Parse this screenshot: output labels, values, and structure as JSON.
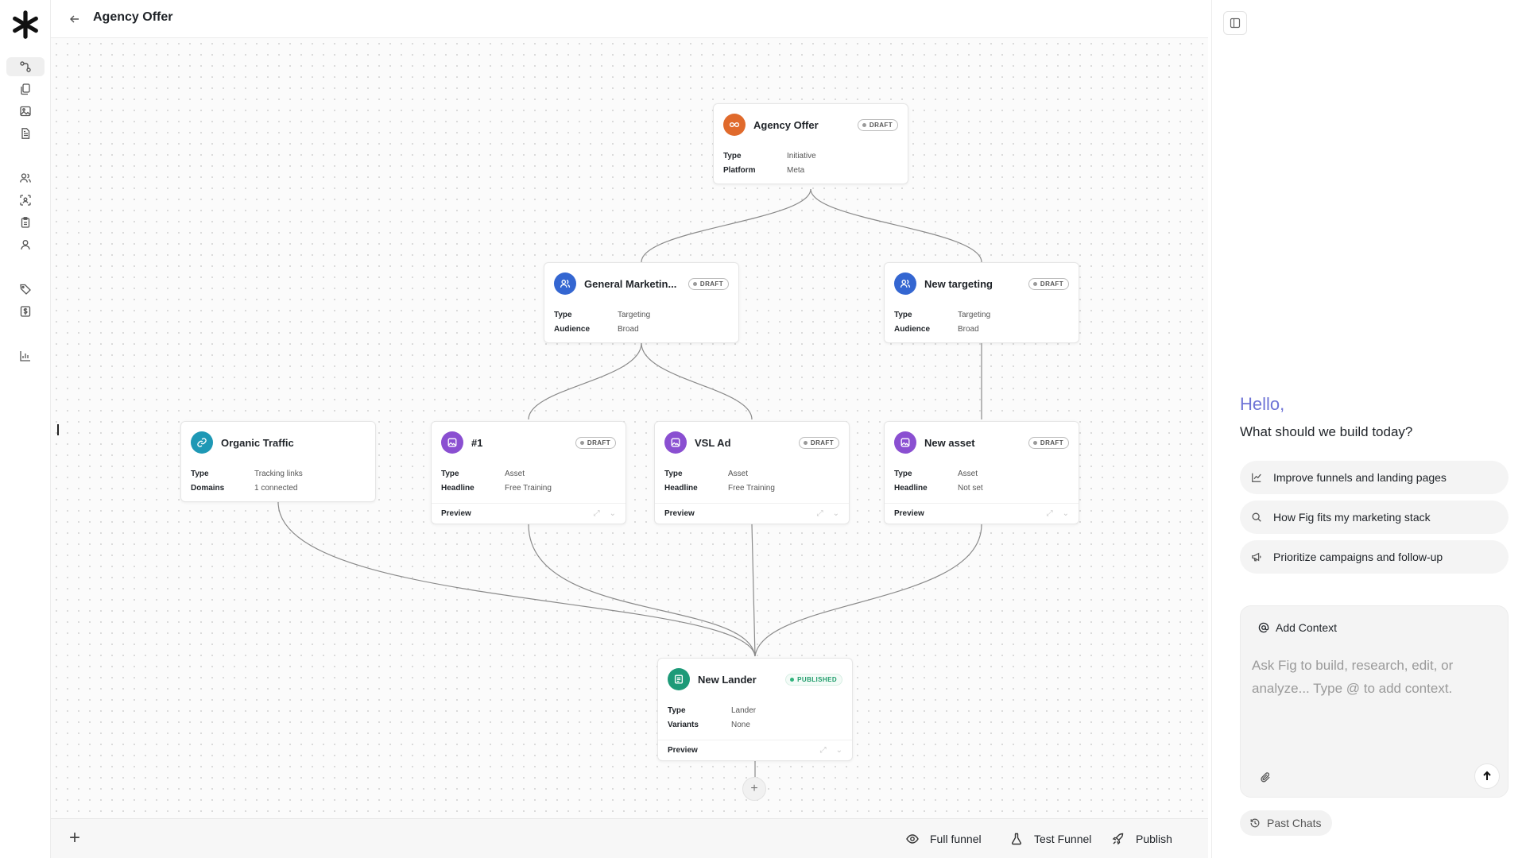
{
  "header": {
    "title": "Agency Offer"
  },
  "rail": {
    "items": [
      {
        "name": "funnels",
        "icon": "flow-icon",
        "active": true
      },
      {
        "name": "copies",
        "icon": "copy-icon"
      },
      {
        "name": "images",
        "icon": "image-icon"
      },
      {
        "name": "documents",
        "icon": "document-icon"
      },
      {
        "name": "audiences",
        "icon": "users-icon"
      },
      {
        "name": "scan",
        "icon": "scan-icon"
      },
      {
        "name": "clipboard",
        "icon": "clipboard-icon"
      },
      {
        "name": "profile",
        "icon": "user-icon"
      },
      {
        "name": "tags",
        "icon": "tag-icon"
      },
      {
        "name": "billing",
        "icon": "dollar-icon"
      },
      {
        "name": "analytics",
        "icon": "bar-chart-icon"
      }
    ]
  },
  "nodes": {
    "agency_offer": {
      "title": "Agency Offer",
      "badge": "DRAFT",
      "icon": "infinity-icon",
      "color": "#e06a2c",
      "props": [
        {
          "k": "Type",
          "v": "Initiative"
        },
        {
          "k": "Platform",
          "v": "Meta"
        }
      ]
    },
    "general_marketing": {
      "title": "General Marketin...",
      "badge": "DRAFT",
      "icon": "users-icon",
      "color": "#3466d1",
      "props": [
        {
          "k": "Type",
          "v": "Targeting"
        },
        {
          "k": "Audience",
          "v": "Broad"
        }
      ]
    },
    "new_targeting": {
      "title": "New targeting",
      "badge": "DRAFT",
      "icon": "users-icon",
      "color": "#3466d1",
      "props": [
        {
          "k": "Type",
          "v": "Targeting"
        },
        {
          "k": "Audience",
          "v": "Broad"
        }
      ]
    },
    "organic_traffic": {
      "title": "Organic Traffic",
      "icon": "link-icon",
      "color": "#1e98b5",
      "props": [
        {
          "k": "Type",
          "v": "Tracking links"
        },
        {
          "k": "Domains",
          "v": "1 connected"
        }
      ]
    },
    "asset_1": {
      "title": "#1",
      "badge": "DRAFT",
      "icon": "image-icon",
      "color": "#8a4fd1",
      "props": [
        {
          "k": "Type",
          "v": "Asset"
        },
        {
          "k": "Headline",
          "v": "Free Training"
        }
      ],
      "preview": "Preview"
    },
    "vsl_ad": {
      "title": "VSL Ad",
      "badge": "DRAFT",
      "icon": "image-icon",
      "color": "#8a4fd1",
      "props": [
        {
          "k": "Type",
          "v": "Asset"
        },
        {
          "k": "Headline",
          "v": "Free Training"
        }
      ],
      "preview": "Preview"
    },
    "new_asset": {
      "title": "New asset",
      "badge": "DRAFT",
      "icon": "image-icon",
      "color": "#8a4fd1",
      "props": [
        {
          "k": "Type",
          "v": "Asset"
        },
        {
          "k": "Headline",
          "v": "Not set"
        }
      ],
      "preview": "Preview"
    },
    "new_lander": {
      "title": "New Lander",
      "badge": "PUBLISHED",
      "icon": "page-icon",
      "color": "#1d9a78",
      "props": [
        {
          "k": "Type",
          "v": "Lander"
        },
        {
          "k": "Variants",
          "v": "None"
        }
      ],
      "preview": "Preview"
    }
  },
  "canvas": {
    "add_node_label": "+"
  },
  "toolbar": {
    "add_label": "+",
    "full_funnel": "Full funnel",
    "test_funnel": "Test Funnel",
    "publish": "Publish"
  },
  "panel": {
    "greeting": "Hello,",
    "subtitle": "What should we build today?",
    "suggestions": [
      {
        "label": "Improve funnels and landing pages",
        "icon": "line-chart-icon"
      },
      {
        "label": "How Fig fits my marketing stack",
        "icon": "search-icon"
      },
      {
        "label": "Prioritize campaigns and follow-up",
        "icon": "megaphone-icon"
      }
    ],
    "add_context": "Add Context",
    "input_placeholder": "Ask Fig to build, research, edit, or analyze... Type @ to add context.",
    "past_chats": "Past Chats"
  },
  "colors": {
    "accent_greeting": "#6e73d6",
    "published": "#2fb37c"
  }
}
